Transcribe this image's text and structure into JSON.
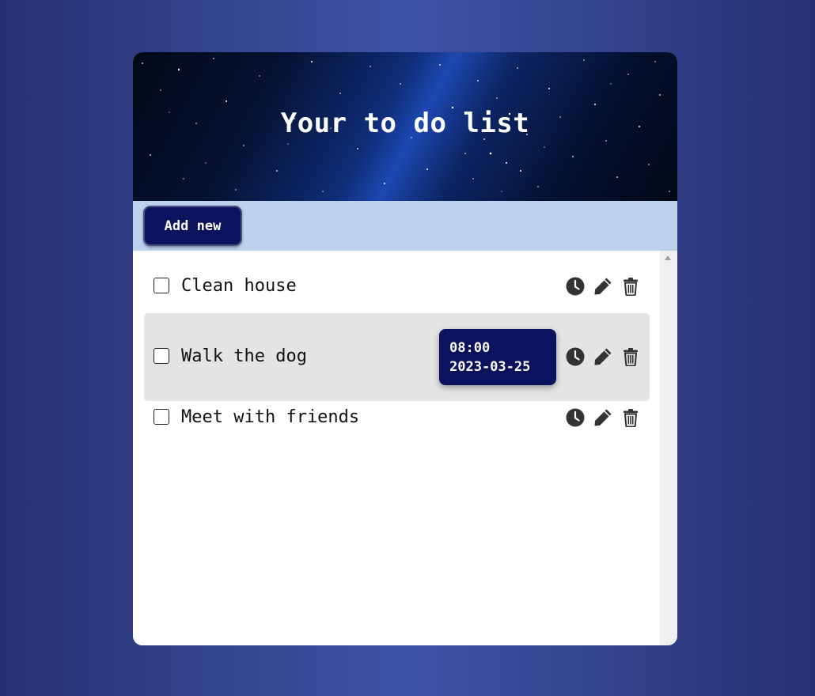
{
  "header": {
    "title": "Your to do list"
  },
  "toolbar": {
    "add_label": "Add new"
  },
  "todos": [
    {
      "label": "Clean house",
      "checked": false
    },
    {
      "label": "Walk the dog",
      "checked": false,
      "hovered": true,
      "tooltip": {
        "time": "08:00",
        "date": "2023-03-25"
      }
    },
    {
      "label": "Meet with friends",
      "checked": false
    }
  ],
  "icons": [
    "clock-icon",
    "pencil-icon",
    "trash-icon"
  ],
  "colors": {
    "background_dark": "#273172",
    "background_light": "#3f53a5",
    "toolbar": "#bcd2ec",
    "button": "#0b125e",
    "highlight_row": "#e4e4e4",
    "icon": "#333333"
  }
}
